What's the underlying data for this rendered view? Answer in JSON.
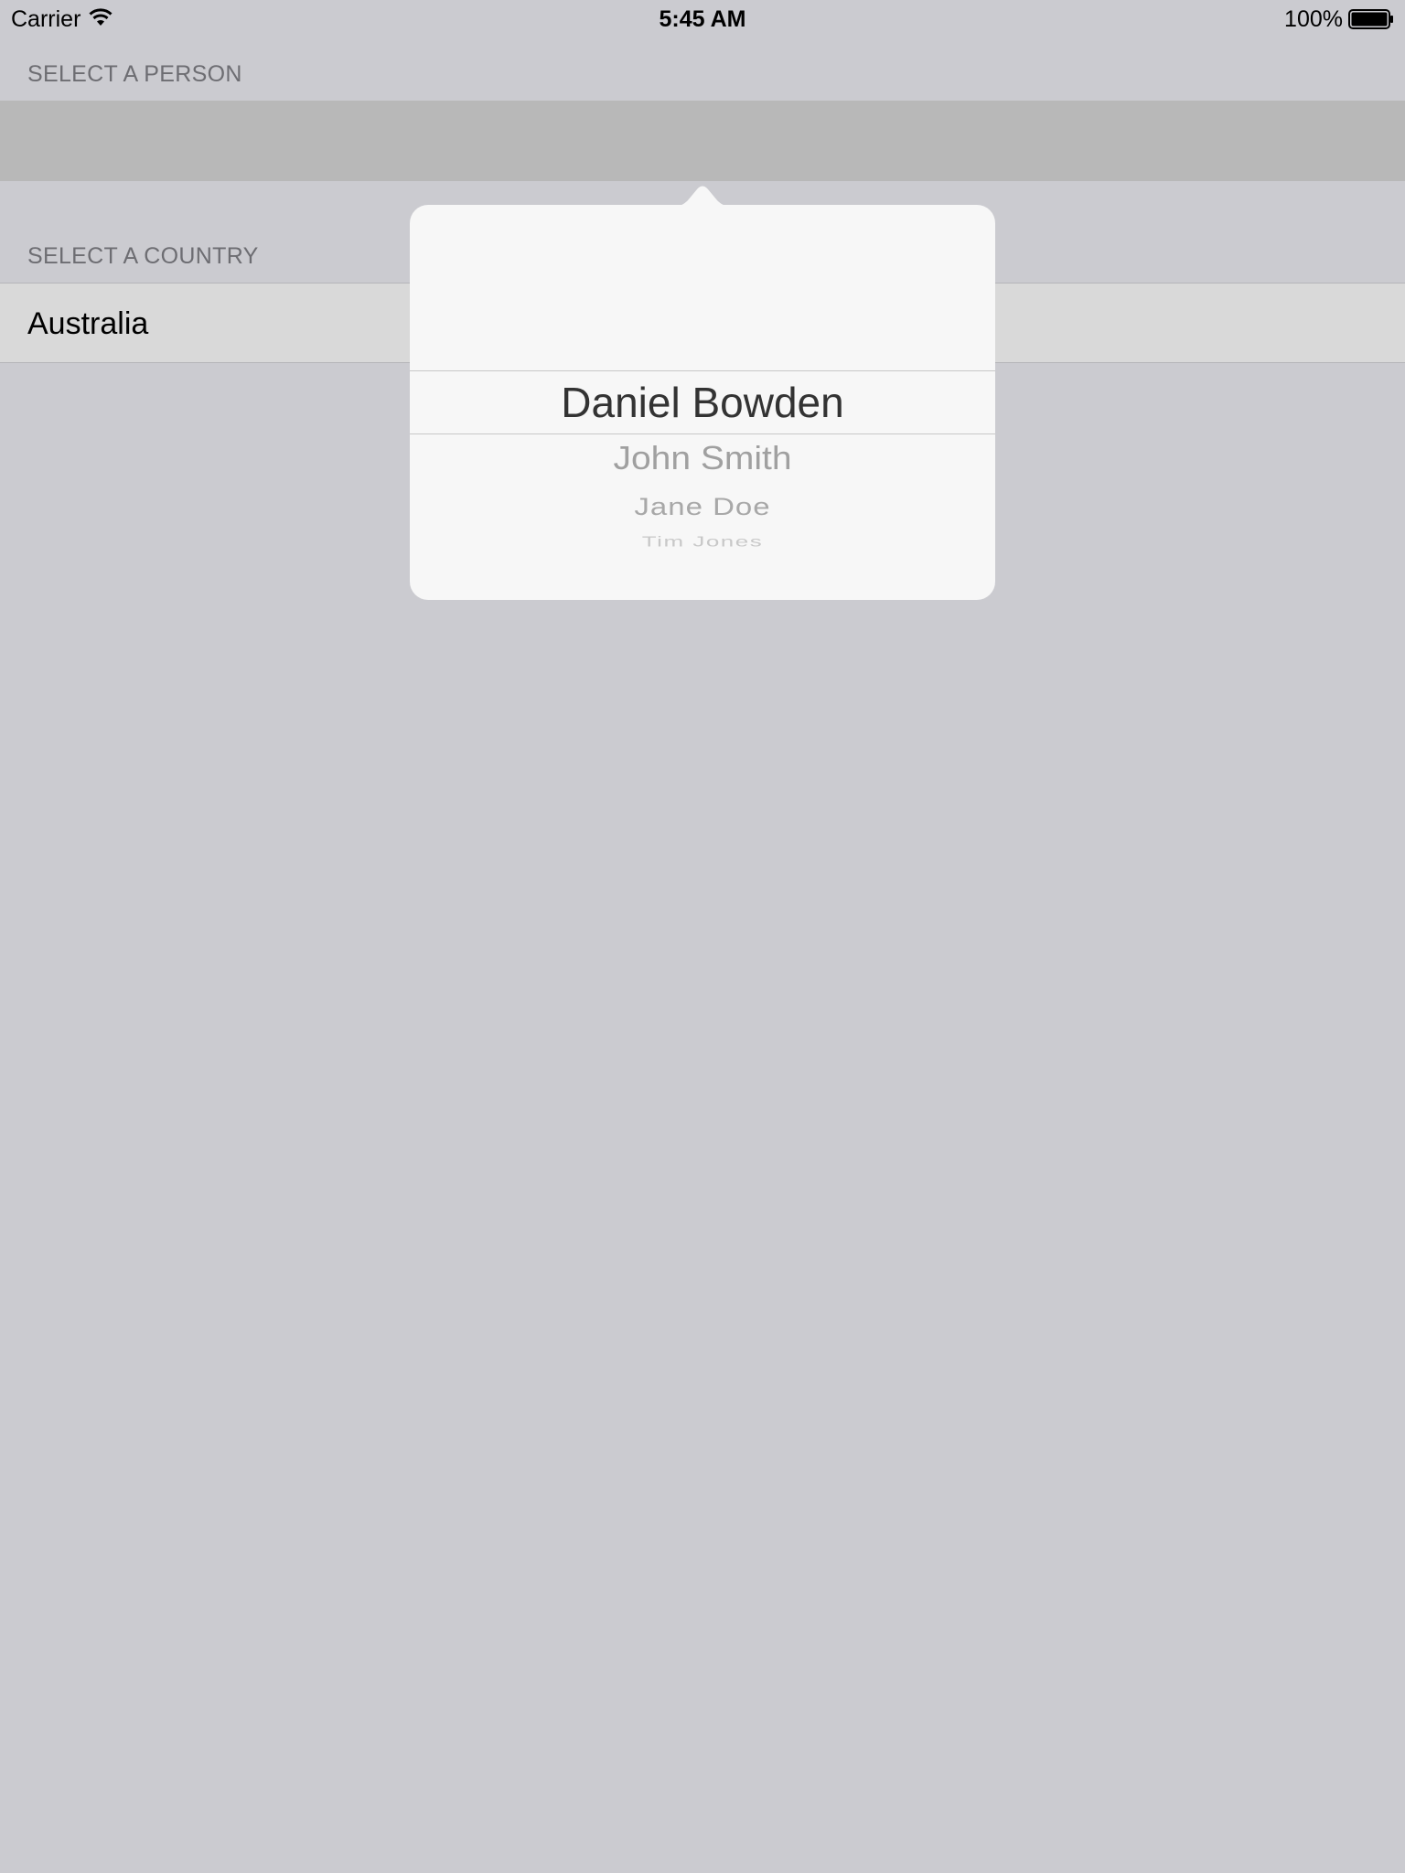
{
  "status_bar": {
    "carrier": "Carrier",
    "time": "5:45 AM",
    "battery": "100%"
  },
  "sections": {
    "person_header": "SELECT A PERSON",
    "country_header": "SELECT A COUNTRY",
    "country_value": "Australia"
  },
  "picker": {
    "selected": "Daniel Bowden",
    "items": [
      "John Smith",
      "Jane Doe",
      "Tim Jones"
    ]
  }
}
